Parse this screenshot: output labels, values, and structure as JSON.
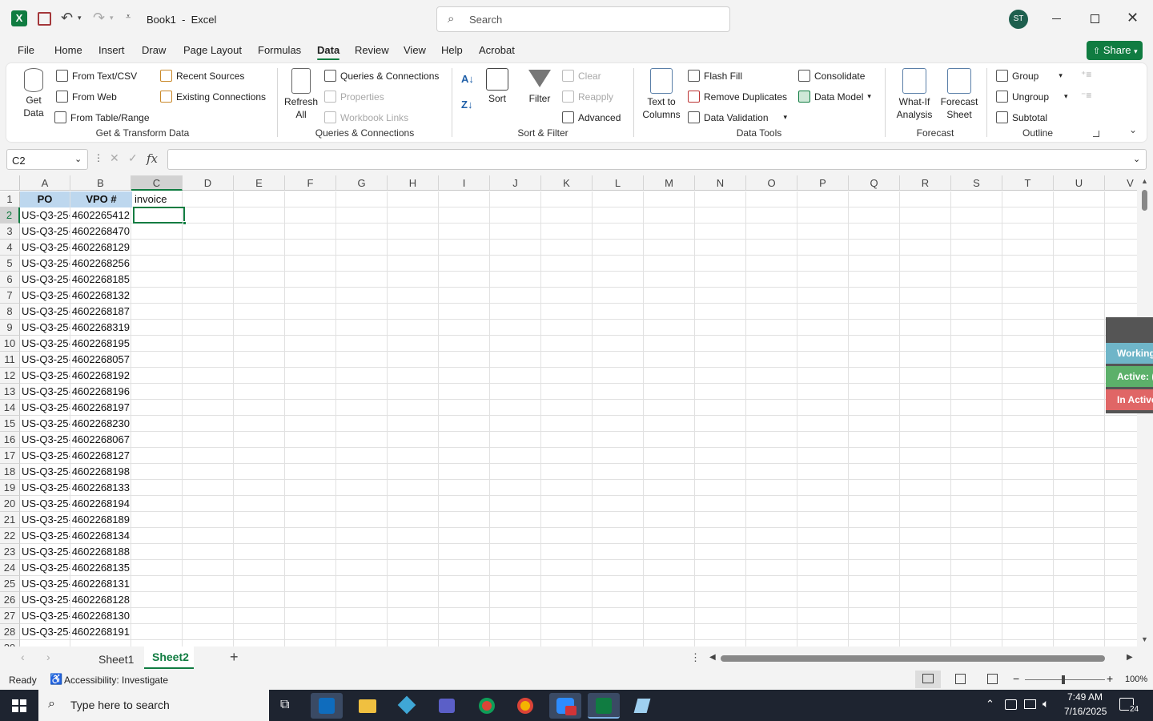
{
  "titlebar": {
    "title": "Book1  -  Excel",
    "search_placeholder": "Search",
    "avatar_initials": "ST",
    "share_label": "Share"
  },
  "menu": [
    "File",
    "Home",
    "Insert",
    "Draw",
    "Page Layout",
    "Formulas",
    "Data",
    "Review",
    "View",
    "Help",
    "Acrobat"
  ],
  "ribbon": {
    "get_data": "Get\nData",
    "from_text_csv": "From Text/CSV",
    "from_web": "From Web",
    "from_table_range": "From Table/Range",
    "recent_sources": "Recent Sources",
    "existing_connections": "Existing Connections",
    "group_get_transform": "Get & Transform Data",
    "refresh_all": "Refresh\nAll",
    "queries_connections": "Queries & Connections",
    "properties": "Properties",
    "workbook_links": "Workbook Links",
    "group_queries": "Queries & Connections",
    "sort": "Sort",
    "filter": "Filter",
    "clear": "Clear",
    "reapply": "Reapply",
    "advanced": "Advanced",
    "group_sort_filter": "Sort & Filter",
    "text_to_columns": "Text to\nColumns",
    "flash_fill": "Flash Fill",
    "remove_duplicates": "Remove Duplicates",
    "data_validation": "Data Validation",
    "consolidate": "Consolidate",
    "data_model": "Data Model",
    "group_data_tools": "Data Tools",
    "what_if": "What-If\nAnalysis",
    "forecast_sheet": "Forecast\nSheet",
    "group_forecast": "Forecast",
    "group_btn": "Group",
    "ungroup": "Ungroup",
    "subtotal": "Subtotal",
    "group_outline": "Outline"
  },
  "formula_bar": {
    "name_box": "C2",
    "fx": "fx",
    "formula": ""
  },
  "columns": [
    "A",
    "B",
    "C",
    "D",
    "E",
    "F",
    "G",
    "H",
    "I",
    "J",
    "K",
    "L",
    "M",
    "N",
    "O",
    "P",
    "Q",
    "R",
    "S",
    "T",
    "U",
    "V"
  ],
  "rows": [
    [
      "PO",
      "VPO #",
      "invoice"
    ],
    [
      "US-Q3-25-",
      "4602265412",
      ""
    ],
    [
      "US-Q3-25-",
      "4602268470",
      ""
    ],
    [
      "US-Q3-25-",
      "4602268129",
      ""
    ],
    [
      "US-Q3-25-",
      "4602268256",
      ""
    ],
    [
      "US-Q3-25-",
      "4602268185",
      ""
    ],
    [
      "US-Q3-25-",
      "4602268132",
      ""
    ],
    [
      "US-Q3-25-",
      "4602268187",
      ""
    ],
    [
      "US-Q3-25-",
      "4602268319",
      ""
    ],
    [
      "US-Q3-25-",
      "4602268195",
      ""
    ],
    [
      "US-Q3-25-",
      "4602268057",
      ""
    ],
    [
      "US-Q3-25-",
      "4602268192",
      ""
    ],
    [
      "US-Q3-25-",
      "4602268196",
      ""
    ],
    [
      "US-Q3-25-",
      "4602268197",
      ""
    ],
    [
      "US-Q3-25-",
      "4602268230",
      ""
    ],
    [
      "US-Q3-25-",
      "4602268067",
      ""
    ],
    [
      "US-Q3-25-",
      "4602268127",
      ""
    ],
    [
      "US-Q3-25-",
      "4602268198",
      ""
    ],
    [
      "US-Q3-25-",
      "4602268133",
      ""
    ],
    [
      "US-Q3-25-",
      "4602268194",
      ""
    ],
    [
      "US-Q3-25-",
      "4602268189",
      ""
    ],
    [
      "US-Q3-25-",
      "4602268134",
      ""
    ],
    [
      "US-Q3-25-",
      "4602268188",
      ""
    ],
    [
      "US-Q3-25-",
      "4602268135",
      ""
    ],
    [
      "US-Q3-25-",
      "4602268131",
      ""
    ],
    [
      "US-Q3-25-",
      "4602268128",
      ""
    ],
    [
      "US-Q3-25-",
      "4602268130",
      ""
    ],
    [
      "US-Q3-25-",
      "4602268191",
      ""
    ]
  ],
  "side_panel": {
    "working": "Working",
    "active": "Active: (",
    "inactive": "In Active"
  },
  "sheets": {
    "sheet1": "Sheet1",
    "sheet2": "Sheet2",
    "add": "+"
  },
  "status": {
    "ready": "Ready",
    "accessibility": "Accessibility: Investigate",
    "zoom": "100%"
  },
  "taskbar": {
    "search_placeholder": "Type here to search",
    "time": "7:49 AM",
    "date": "7/16/2025",
    "notifications": "24"
  },
  "colors": {
    "excel_green": "#107c41",
    "header_fill": "#bdd7ee",
    "working": "#6fb5c8",
    "active": "#5cb06a",
    "inactive": "#e06666"
  }
}
